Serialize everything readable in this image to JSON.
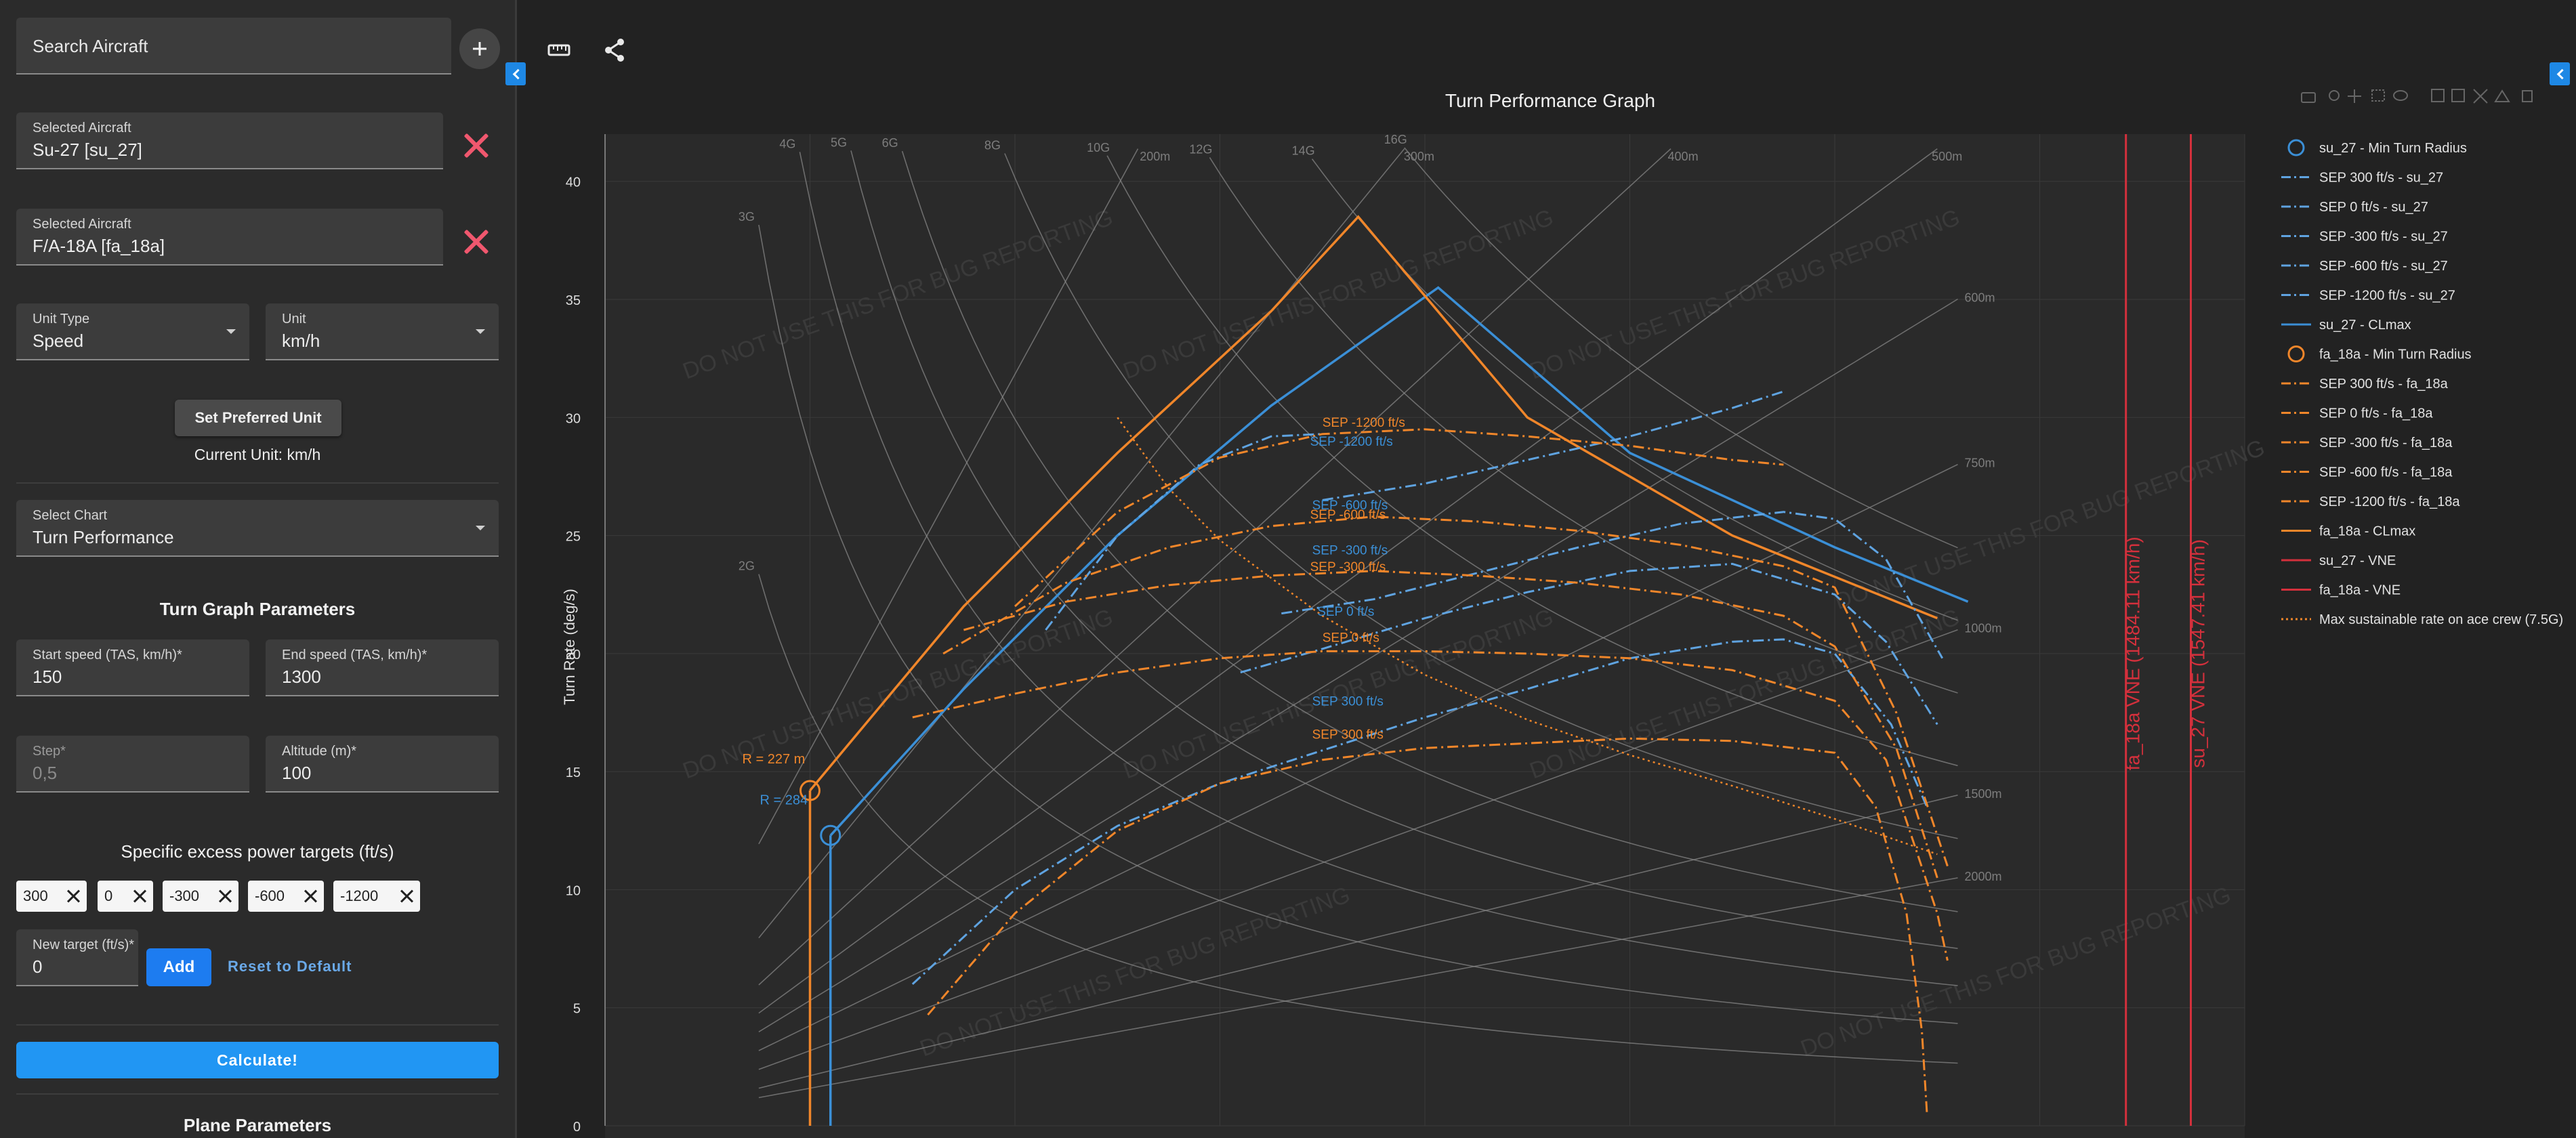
{
  "sidebar": {
    "search_placeholder": "Search Aircraft",
    "selected": [
      {
        "label": "Selected Aircraft",
        "value": "Su-27 [su_27]"
      },
      {
        "label": "Selected Aircraft",
        "value": "F/A-18A [fa_18a]"
      }
    ],
    "unit_type": {
      "label": "Unit Type",
      "value": "Speed"
    },
    "unit": {
      "label": "Unit",
      "value": "km/h"
    },
    "set_preferred": "Set Preferred Unit",
    "current_unit": "Current Unit: km/h",
    "select_chart": {
      "label": "Select Chart",
      "value": "Turn Performance"
    },
    "turn_params_title": "Turn Graph Parameters",
    "start_speed": {
      "label": "Start speed (TAS, km/h)",
      "value": "150"
    },
    "end_speed": {
      "label": "End speed (TAS, km/h)",
      "value": "1300"
    },
    "step": {
      "label": "Step",
      "placeholder": "0,5"
    },
    "altitude": {
      "label": "Altitude (m)",
      "value": "100"
    },
    "required_mark": "*",
    "sep_targets_title": "Specific excess power targets (ft/s)",
    "sep_chips": [
      "300",
      "0",
      "-300",
      "-600",
      "-1200"
    ],
    "new_target": {
      "label": "New target (ft/s)",
      "value": "0"
    },
    "add": "Add",
    "reset": "Reset to Default",
    "calculate": "Calculate!",
    "plane_params": "Plane Parameters"
  },
  "colors": {
    "su27": "#3b8fd6",
    "fa18": "#f0862a",
    "vne": "#d4303c",
    "grid": "#3a3a3a"
  },
  "chart_data": {
    "type": "line",
    "title": "Turn Performance Graph",
    "xlabel": "",
    "ylabel": "Turn Rate (deg/s)",
    "xlim": [
      0,
      1600
    ],
    "ylim": [
      0,
      42
    ],
    "yticks": [
      0,
      5,
      10,
      15,
      20,
      25,
      30,
      35,
      40
    ],
    "watermark": "DO NOT USE THIS FOR BUG REPORTING",
    "g_labels": [
      "2G",
      "3G",
      "4G",
      "5G",
      "6G",
      "8G",
      "10G",
      "12G",
      "14G",
      "16G"
    ],
    "radius_labels": [
      "200m",
      "300m",
      "400m",
      "500m",
      "600m",
      "750m",
      "1000m",
      "1500m",
      "2000m"
    ],
    "legend": [
      "su_27 - Min Turn Radius",
      "SEP 300 ft/s - su_27",
      "SEP 0 ft/s - su_27",
      "SEP -300 ft/s - su_27",
      "SEP -600 ft/s - su_27",
      "SEP -1200 ft/s - su_27",
      "su_27 - CLmax",
      "fa_18a - Min Turn Radius",
      "SEP 300 ft/s - fa_18a",
      "SEP 0 ft/s - fa_18a",
      "SEP -300 ft/s - fa_18a",
      "SEP -600 ft/s - fa_18a",
      "SEP -1200 ft/s - fa_18a",
      "fa_18a - CLmax",
      "su_27 - VNE",
      "fa_18a - VNE",
      "Max sustainable rate on ace crew (7.5G)"
    ],
    "annotations": {
      "fa18_radius": "R = 227 m",
      "su27_radius": "R = 284",
      "fa18_vne": "fa_18a VNE (1484.11 km/h)",
      "su27_vne": "su_27 VNE (1547.41 km/h)"
    },
    "series": [
      {
        "name": "su_27 - CLmax",
        "x": [
          220,
          350,
          500,
          650,
          813,
          1000,
          1200,
          1330
        ],
        "y": [
          12.3,
          18.5,
          25.0,
          30.5,
          35.5,
          28.5,
          24.5,
          22.2
        ]
      },
      {
        "name": "fa_18a - CLmax",
        "x": [
          200,
          350,
          500,
          650,
          735,
          900,
          1100,
          1300
        ],
        "y": [
          14.2,
          22.0,
          28.5,
          34.5,
          38.5,
          30.0,
          25.0,
          21.5
        ]
      },
      {
        "name": "SEP 300 ft/s - su_27",
        "x": [
          300,
          400,
          500,
          600,
          700,
          800,
          900,
          1000,
          1100,
          1150,
          1200,
          1255,
          1290
        ],
        "y": [
          6.0,
          10.0,
          12.7,
          14.5,
          15.9,
          17.3,
          18.5,
          19.8,
          20.5,
          20.6,
          20.0,
          17.0,
          13.5
        ]
      },
      {
        "name": "SEP 0 ft/s - su_27",
        "x": [
          620,
          700,
          800,
          900,
          1000,
          1100,
          1200,
          1250,
          1300
        ],
        "y": [
          19.2,
          20.2,
          21.5,
          22.6,
          23.5,
          23.8,
          22.5,
          20.5,
          17.0
        ]
      },
      {
        "name": "SEP -300 ft/s - su_27",
        "x": [
          660,
          750,
          850,
          950,
          1050,
          1150,
          1200,
          1250,
          1305
        ],
        "y": [
          21.7,
          22.3,
          23.4,
          24.5,
          25.5,
          26.0,
          25.7,
          24.0,
          19.8
        ]
      },
      {
        "name": "SEP -600 ft/s - su_27",
        "x": [
          700,
          800,
          900,
          1000,
          1100,
          1150
        ],
        "y": [
          26.5,
          27.2,
          28.2,
          29.2,
          30.4,
          31.1
        ]
      },
      {
        "name": "SEP -1200 ft/s - su_27",
        "x": [
          430,
          500,
          580,
          650,
          700
        ],
        "y": [
          21.0,
          25.0,
          28.0,
          29.2,
          29.3
        ]
      },
      {
        "name": "SEP 300 ft/s - fa_18a",
        "x": [
          315,
          400,
          500,
          600,
          700,
          800,
          900,
          1000,
          1100,
          1200,
          1240,
          1270,
          1285,
          1290
        ],
        "y": [
          4.7,
          9.0,
          12.5,
          14.5,
          15.5,
          16.0,
          16.2,
          16.4,
          16.3,
          15.8,
          13.5,
          9.0,
          4.0,
          0.5
        ]
      },
      {
        "name": "SEP 0 ft/s - fa_18a",
        "x": [
          300,
          400,
          500,
          600,
          700,
          800,
          900,
          1000,
          1100,
          1200,
          1250,
          1300,
          1310
        ],
        "y": [
          17.3,
          18.3,
          19.2,
          19.8,
          20.1,
          20.1,
          20.0,
          19.8,
          19.3,
          18.0,
          15.5,
          9.0,
          7.0
        ]
      },
      {
        "name": "SEP -300 ft/s - fa_18a",
        "x": [
          350,
          450,
          550,
          650,
          750,
          850,
          950,
          1050,
          1150,
          1200,
          1260,
          1300
        ],
        "y": [
          21.0,
          22.2,
          22.9,
          23.3,
          23.5,
          23.3,
          23.0,
          22.5,
          21.6,
          20.3,
          16.0,
          10.5
        ]
      },
      {
        "name": "SEP -600 ft/s - fa_18a",
        "x": [
          330,
          450,
          550,
          650,
          750,
          850,
          950,
          1050,
          1150,
          1200,
          1260,
          1310
        ],
        "y": [
          20.0,
          23.0,
          24.5,
          25.4,
          25.8,
          25.6,
          25.2,
          24.6,
          23.7,
          22.8,
          17.5,
          11.0
        ]
      },
      {
        "name": "SEP -1200 ft/s - fa_18a",
        "x": [
          400,
          500,
          600,
          700,
          800,
          900,
          1000,
          1100,
          1150
        ],
        "y": [
          22.0,
          26.0,
          28.3,
          29.3,
          29.5,
          29.2,
          28.8,
          28.2,
          28.0
        ]
      },
      {
        "name": "Max sustainable rate on ace crew (7.5G)",
        "x": [
          500,
          550,
          600,
          700,
          800,
          900,
          1000,
          1100,
          1200,
          1300
        ],
        "y": [
          30.0,
          27.0,
          24.8,
          21.6,
          19.1,
          17.2,
          15.7,
          14.4,
          13.0,
          11.5
        ]
      },
      {
        "name": "su_27 - VNE",
        "x": [
          1547.41,
          1547.41
        ],
        "y": [
          0,
          42
        ]
      },
      {
        "name": "fa_18a - VNE",
        "x": [
          1484.11,
          1484.11
        ],
        "y": [
          0,
          42
        ]
      }
    ],
    "sep_labels": [
      {
        "text": "SEP -1200 ft/s",
        "x": 700,
        "y": 29.6,
        "ac": "fa"
      },
      {
        "text": "SEP -1200 ft/s",
        "x": 688,
        "y": 28.8,
        "ac": "su"
      },
      {
        "text": "SEP -600 ft/s",
        "x": 690,
        "y": 26.1,
        "ac": "su"
      },
      {
        "text": "SEP -600 ft/s",
        "x": 688,
        "y": 25.7,
        "ac": "fa"
      },
      {
        "text": "SEP -300 ft/s",
        "x": 690,
        "y": 24.2,
        "ac": "su"
      },
      {
        "text": "SEP -300 ft/s",
        "x": 688,
        "y": 23.5,
        "ac": "fa"
      },
      {
        "text": "SEP 0 ft/s",
        "x": 695,
        "y": 21.6,
        "ac": "su"
      },
      {
        "text": "SEP 0 ft/s",
        "x": 700,
        "y": 20.5,
        "ac": "fa"
      },
      {
        "text": "SEP 300 ft/s",
        "x": 690,
        "y": 17.8,
        "ac": "su"
      },
      {
        "text": "SEP 300 ft/s",
        "x": 690,
        "y": 16.4,
        "ac": "fa"
      }
    ]
  }
}
